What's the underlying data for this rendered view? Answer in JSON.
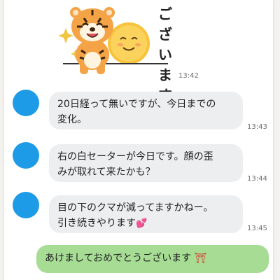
{
  "sticker": {
    "text": "ございます",
    "time": "13:42"
  },
  "messages": [
    {
      "lines": [
        "20日経って無いですが、今日までの",
        "変化。"
      ],
      "time": "13:43"
    },
    {
      "lines": [
        "右の白セーターが今日です。顔の歪",
        "みが取れて来たかも？"
      ],
      "time": "13:44"
    },
    {
      "lines": [
        "目の下のクマが減ってますかねー。",
        "引き続きやります"
      ],
      "emoji": "💕",
      "time": "13:45"
    }
  ],
  "outgoing": {
    "text": "あけましておめでとうございます",
    "emoji": "⛩"
  }
}
